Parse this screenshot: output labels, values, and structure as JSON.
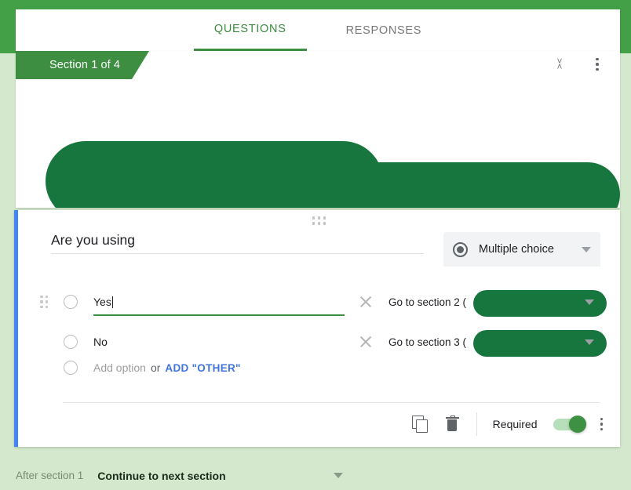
{
  "theme": {
    "accent_green": "#3e8e41",
    "header_green": "#43a047",
    "page_background": "#d3e8cc",
    "redaction_green": "#16763d",
    "active_card_border": "#4285f4",
    "link_blue": "#3f74e0"
  },
  "tabs": [
    {
      "label": "QUESTIONS",
      "active": true
    },
    {
      "label": "RESPONSES",
      "active": false
    }
  ],
  "section": {
    "tab_label": "Section 1 of 4",
    "title_redacted": true,
    "description_redacted": true,
    "collapse_icon": "collapse-chevrons-icon",
    "more_icon": "more-vert-icon"
  },
  "question": {
    "title_prefix": "Are you using",
    "title_redacted_suffix": true,
    "type": {
      "label": "Multiple choice",
      "icon": "radio-button-icon",
      "caret_icon": "chevron-down-icon"
    },
    "options": [
      {
        "text": "Yes",
        "focused": true,
        "has_drag_handle": true,
        "remove_icon": "close-icon",
        "goto": {
          "prefix": "Go to section 2 (",
          "suffix": ")",
          "name_redacted": true
        }
      },
      {
        "text": "No",
        "focused": false,
        "has_drag_handle": false,
        "remove_icon": "close-icon",
        "goto": {
          "prefix": "Go to section 3 (",
          "suffix": ")",
          "name_redacted": true
        }
      }
    ],
    "add_option": {
      "label": "Add option",
      "or": "or",
      "add_other": "ADD \"OTHER\""
    },
    "footer": {
      "duplicate_icon": "copy-icon",
      "delete_icon": "trash-icon",
      "required_label": "Required",
      "required_on": true,
      "more_icon": "more-vert-icon"
    }
  },
  "bottom_bar": {
    "after_label": "After section 1",
    "after_value": "Continue to next section",
    "caret_icon": "chevron-down-icon"
  }
}
